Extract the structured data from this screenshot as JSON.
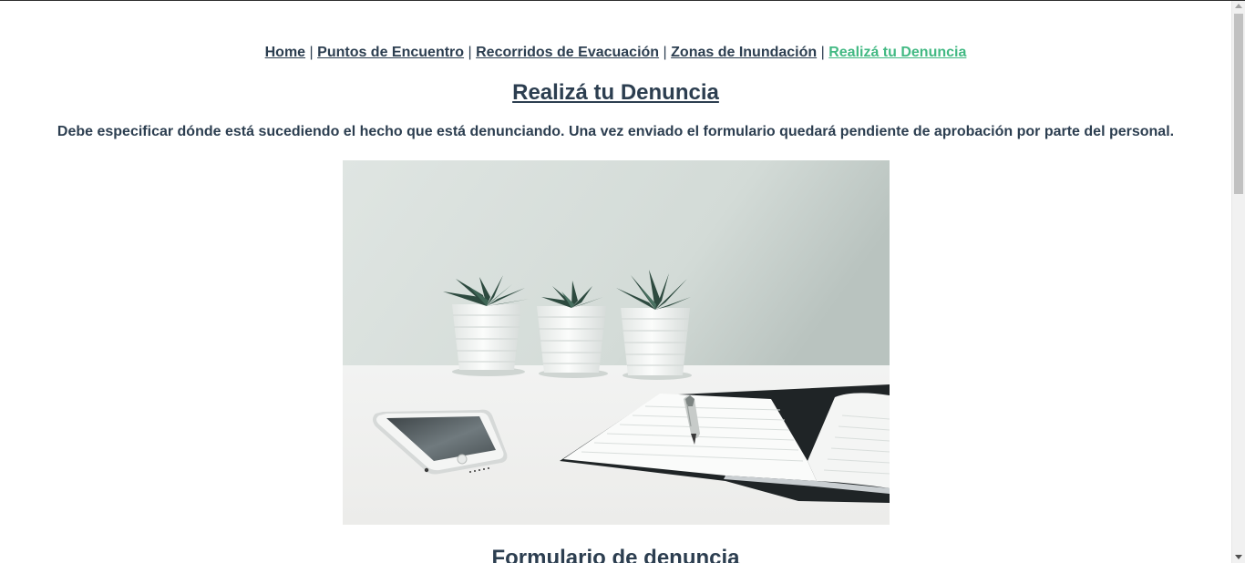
{
  "nav": {
    "items": [
      {
        "label": "Home"
      },
      {
        "label": "Puntos de Encuentro"
      },
      {
        "label": "Recorridos de Evacuación"
      },
      {
        "label": "Zonas de Inundación"
      },
      {
        "label": "Realizá tu Denuncia"
      }
    ],
    "separator": "|",
    "active_color": "#42b983"
  },
  "page": {
    "title": "Realizá tu Denuncia",
    "description": "Debe especificar dónde está sucediendo el hecho que está denunciando. Una vez enviado el formulario quedará pendiente de aprobación por parte del personal.",
    "image_icon": "desk-plants-notebook-phone-photo",
    "form_title": "Formulario de denuncia"
  },
  "colors": {
    "text": "#2c3e50",
    "accent": "#42b983"
  }
}
